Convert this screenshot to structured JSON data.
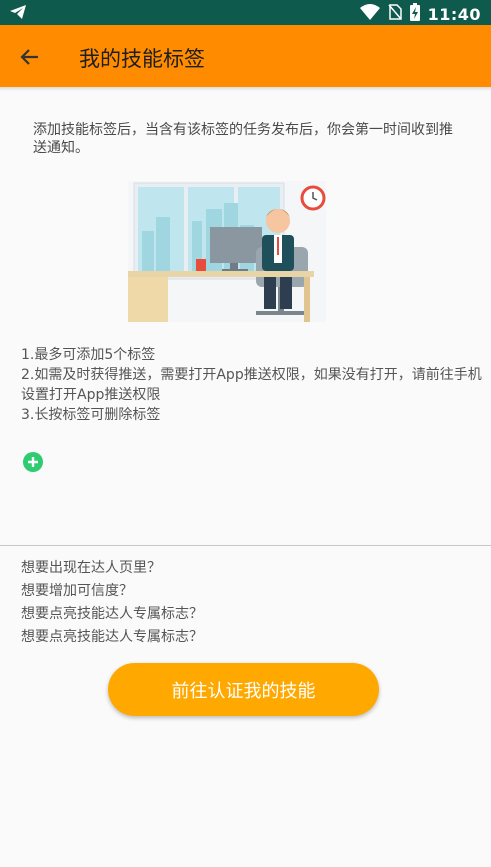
{
  "status_bar": {
    "time": "11:40",
    "icons": [
      "telegram-icon",
      "wifi-icon",
      "no-sim-icon",
      "battery-charging-icon"
    ]
  },
  "app_bar": {
    "title": "我的技能标签",
    "back_icon": "arrow-left-icon",
    "background": "#ff8c00"
  },
  "intro_text": "添加技能标签后，当含有该标签的任务发布后，你会第一时间收到推送通知。",
  "rules": [
    "1.最多可添加5个标签",
    "2.如需及时获得推送，需要打开App推送权限，如果没有打开，请前往手机设置打开App推送权限",
    "3.长按标签可删除标签"
  ],
  "add_tag_icon": "plus-circle-icon",
  "questions": [
    "想要出现在达人页里？",
    "想要增加可信度？",
    "想要点亮技能达人专属标志？",
    "想要点亮技能达人专属标志？"
  ],
  "cta_label": "前往认证我的技能",
  "colors": {
    "status_bar": "#0e5a4c",
    "accent": "#ff8c00",
    "button": "#ffa800",
    "add_icon": "#2ecc71"
  }
}
